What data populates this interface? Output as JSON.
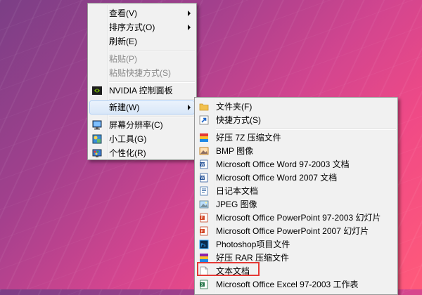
{
  "context_menu": {
    "items": [
      {
        "label": "查看(V)"
      },
      {
        "label": "排序方式(O)"
      },
      {
        "label": "刷新(E)"
      },
      {
        "label": "粘贴(P)"
      },
      {
        "label": "粘贴快捷方式(S)"
      },
      {
        "label": "NVIDIA 控制面板"
      },
      {
        "label": "新建(W)"
      },
      {
        "label": "屏幕分辨率(C)"
      },
      {
        "label": "小工具(G)"
      },
      {
        "label": "个性化(R)"
      }
    ]
  },
  "new_submenu": {
    "items": [
      {
        "label": "文件夹(F)"
      },
      {
        "label": "快捷方式(S)"
      },
      {
        "label": "好压 7Z 压缩文件"
      },
      {
        "label": "BMP 图像"
      },
      {
        "label": "Microsoft Office Word 97-2003 文档"
      },
      {
        "label": "Microsoft Office Word 2007 文档"
      },
      {
        "label": "日记本文档"
      },
      {
        "label": "JPEG 图像"
      },
      {
        "label": "Microsoft Office PowerPoint 97-2003 幻灯片"
      },
      {
        "label": "Microsoft Office PowerPoint 2007 幻灯片"
      },
      {
        "label": "Photoshop项目文件"
      },
      {
        "label": "好压 RAR 压缩文件"
      },
      {
        "label": "文本文档"
      },
      {
        "label": "Microsoft Office Excel 97-2003 工作表"
      }
    ]
  },
  "colors": {
    "menu_bg": "#f1f1f1",
    "hover_bg": "#d9e7f8",
    "highlight_border": "#e53935"
  }
}
